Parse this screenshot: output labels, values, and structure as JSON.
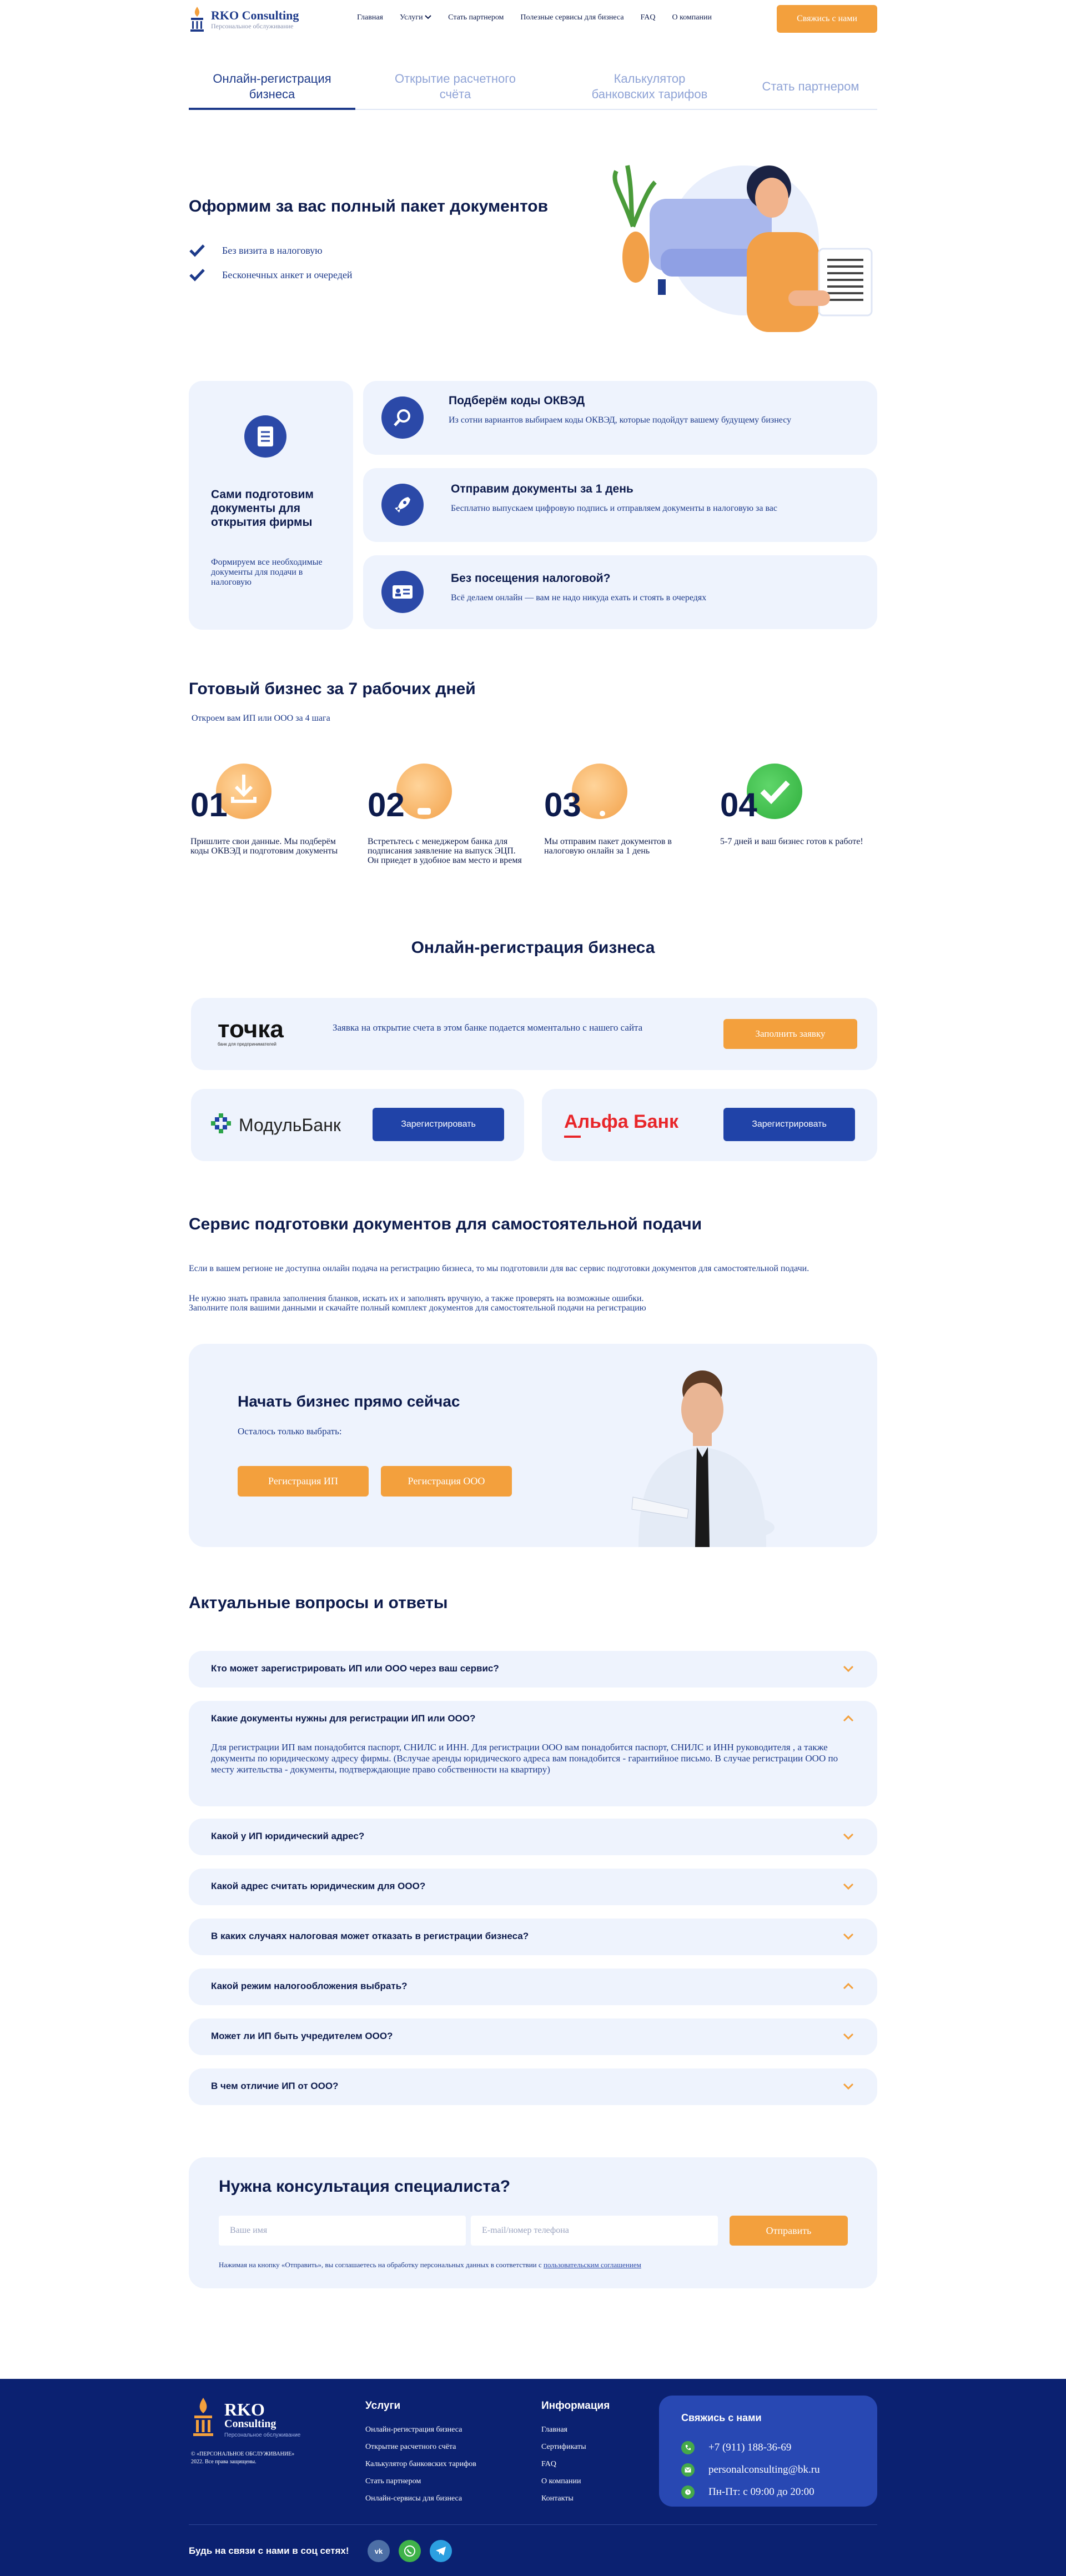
{
  "header": {
    "logo_title": "RKO Consulting",
    "logo_subtitle": "Персональное обслуживание",
    "nav": [
      "Главная",
      "Услуги",
      "Стать партнером",
      "Полезные сервисы для бизнеса",
      "FAQ",
      "О компании"
    ],
    "cta": "Свяжись с нами"
  },
  "tabs": [
    {
      "label": "Онлайн-регистрация бизнеса",
      "active": true
    },
    {
      "label": "Открытие расчетного счёта",
      "active": false
    },
    {
      "label": "Калькулятор банковских тарифов",
      "active": false
    },
    {
      "label": "Стать партнером",
      "active": false
    }
  ],
  "hero": {
    "title": "Оформим за вас полный пакет документов",
    "checks": [
      "Без визита в налоговую",
      "Бесконечных анкет и очередей"
    ]
  },
  "features": {
    "big_title": "Сами подготовим документы для открытия фирмы",
    "big_text": "Формируем все необходимые документы для подачи в налоговую",
    "rows": [
      {
        "title": "Подберём коды ОКВЭД",
        "text": "Из сотни вариантов выбираем коды ОКВЭД, которые подойдут вашему будущему бизнесу",
        "icon": "search-icon"
      },
      {
        "title": "Отправим документы за 1 день",
        "text": "Бесплатно выпускаем цифровую подпись и отправляем документы в налоговую за вас",
        "icon": "rocket-icon"
      },
      {
        "title": "Без посещения налоговой?",
        "text": "Всё делаем онлайн — вам не надо никуда ехать и стоять в очередях",
        "icon": "id-card-icon"
      }
    ]
  },
  "steps": {
    "title": "Готовый бизнес за 7 рабочих дней",
    "subtitle": "Откроем вам ИП или ООО за 4 шага",
    "items": [
      {
        "num": "01",
        "text": "Пришлите свои данные. Мы подберём коды ОКВЭД и подготовим документы"
      },
      {
        "num": "02",
        "text": "Встретьтесь с менеджером банка для подписания заявление на выпуск ЭЦП. Он приедет в удобное вам место и время"
      },
      {
        "num": "03",
        "text": "Мы отправим пакет документов в налоговую онлайн за 1 день"
      },
      {
        "num": "04",
        "text": "5-7 дней и ваш бизнес готов к работе!"
      }
    ]
  },
  "banks": {
    "title": "Онлайн-регистрация бизнеса",
    "tochka": {
      "logo": "точка",
      "logo_sub": "банк для предпринимателей",
      "text": "Заявка на открытие счета в этом банке подается моментально с нашего сайта",
      "button": "Заполнить заявку"
    },
    "modul": {
      "logo": "МодульБанк",
      "button": "Зарегистрировать"
    },
    "alfa": {
      "logo": "Альфа Банк",
      "button": "Зарегистрировать"
    }
  },
  "service": {
    "title": "Сервис подготовки документов для самостоятельной подачи",
    "p1": "Если в вашем регионе не доступна онлайн подача на регистрацию бизнеса, то мы подготовили для вас сервис подготовки документов для самостоятельной подачи.",
    "p2": "Не нужно знать правила заполнения бланков, искать их и заполнять вручную, а также проверять на возможные ошибки.",
    "p3": "Заполните поля вашими данными и скачайте полный комплект документов для самостоятельной подачи на регистрацию"
  },
  "start": {
    "title": "Начать бизнес прямо сейчас",
    "subtitle": "Осталось только выбрать:",
    "btn_ip": "Регистрация ИП",
    "btn_ooo": "Регистрация ООО"
  },
  "faq": {
    "title": "Актуальные вопросы и ответы",
    "items": [
      {
        "q": "Кто может зарегистрировать ИП или ООО через ваш сервис?"
      },
      {
        "q": "Какие документы нужны для регистрации ИП или ООО?",
        "a": "Для регистрации ИП вам понадобится паспорт, СНИЛС и ИНН. Для регистрации ООО вам понадобится паспорт, СНИЛС и ИНН руководителя , а также документы по юридическому адресу фирмы. (Вслучае аренды юридического адреса вам понадобится - гарантийное письмо. В случае регистрации ООО по месту жительства - документы, подтверждающие право собственности на квартиру)"
      },
      {
        "q": "Какой у ИП юридический адрес?"
      },
      {
        "q": "Какой адрес считать юридическим для ООО?"
      },
      {
        "q": "В каких случаях налоговая может отказать в регистрации бизнеса?"
      },
      {
        "q": "Какой режим налогообложения выбрать?"
      },
      {
        "q": "Может ли ИП быть учредителем ООО?"
      },
      {
        "q": "В чем отличие ИП от ООО?"
      }
    ]
  },
  "consult": {
    "title": "Нужна консультация специалиста?",
    "name_placeholder": "Ваше имя",
    "contact_placeholder": "E-mail/номер телефона",
    "button": "Отправить",
    "note_prefix": "Нажимая на кнопку «Отправить», вы соглашаетесь на обработку персональных данных в соответствии с ",
    "note_link": "пользовательским соглашением"
  },
  "footer": {
    "logo_title": "RKO",
    "logo_title2": "Consulting",
    "logo_sub": "Персональное обслуживание",
    "copy1": "© «ПЕРСОНАЛЬНОЕ ОБСЛУЖИВАНИЕ»",
    "copy2": "2022. Все права защищены.",
    "services_title": "Услуги",
    "services": [
      "Онлайн-регистрация бизнеса",
      "Открытие расчетного счёта",
      "Калькулятор банковских тарифов",
      "Стать партнером",
      "Онлайн-сервисы для бизнеса"
    ],
    "info_title": "Информация",
    "info": [
      "Главная",
      "Сертификаты",
      "FAQ",
      "О компании",
      "Контакты"
    ],
    "contact_title": "Свяжись с нами",
    "phone": "+7 (911) 188-36-69",
    "email": "personalconsulting@bk.ru",
    "hours": "Пн-Пт: с 09:00 до 20:00",
    "social_text": "Будь на связи с нами в соц сетях!"
  },
  "colors": {
    "accent": "#f3a03d",
    "brand": "#1d3a8a",
    "card_bg": "#eef3fd",
    "footer_bg": "#0b2171"
  }
}
